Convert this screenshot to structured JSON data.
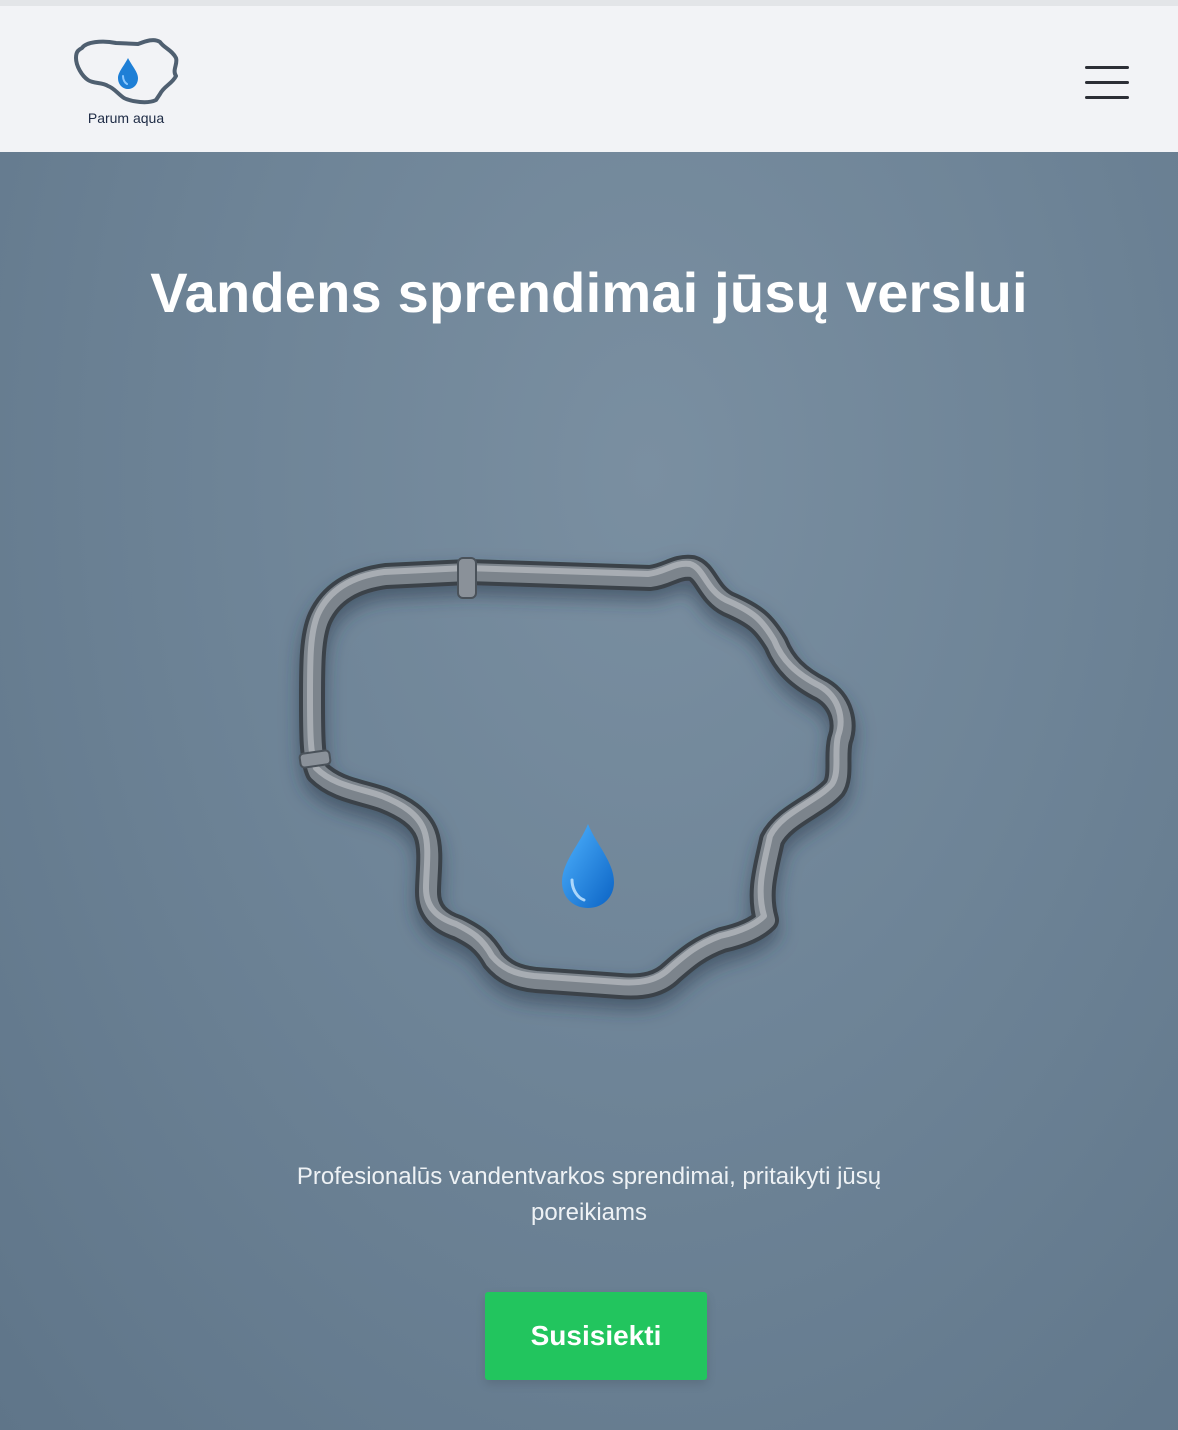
{
  "header": {
    "logo_text": "Parum aqua",
    "menu_label": "Menu"
  },
  "hero": {
    "title": "Vandens sprendimai jūsų verslui",
    "subtitle": "Profesionalūs vandentvarkos sprendimai, pritaikyti jūsų poreikiams",
    "cta_label": "Susisiekti"
  },
  "icons": {
    "logo": "lithuania-outline-water-drop-icon",
    "menu": "hamburger-menu-icon",
    "illustration": "pipe-map-water-drop-icon"
  },
  "colors": {
    "header_bg": "#f2f3f6",
    "hero_bg": "#6f8598",
    "cta_bg": "#22c55e",
    "drop_blue": "#1e88e5"
  }
}
